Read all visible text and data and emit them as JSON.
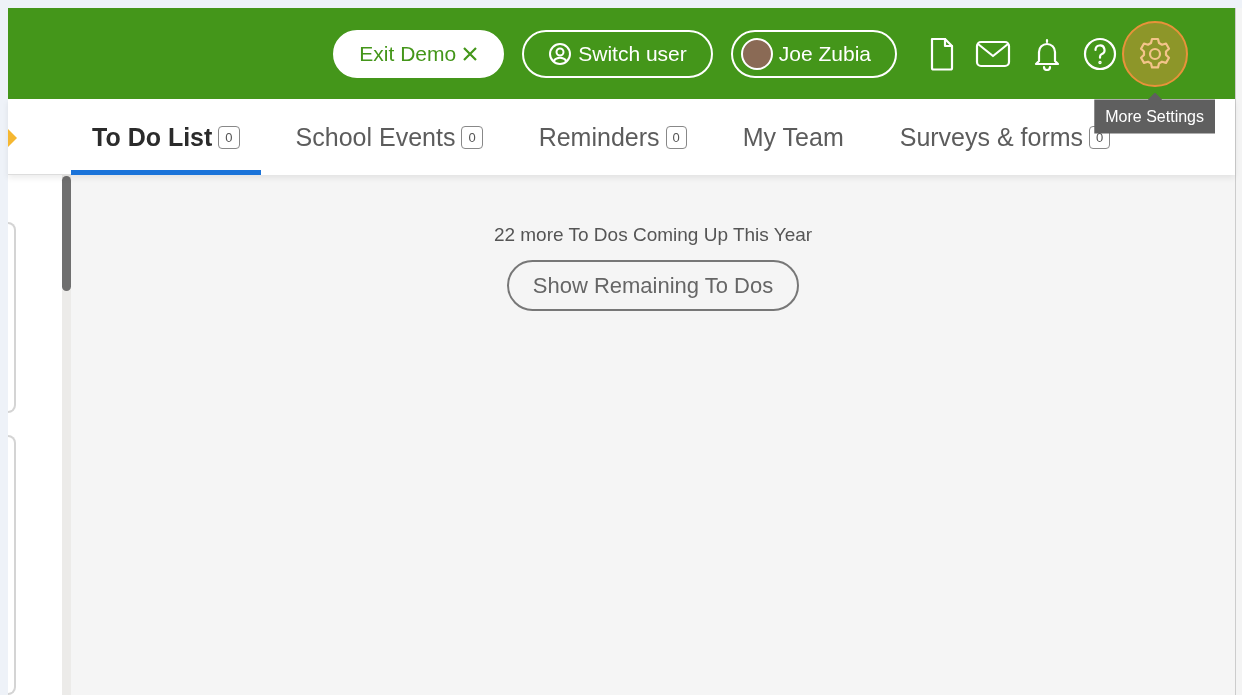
{
  "header": {
    "buttons": [
      {
        "kind": "exit",
        "label": "Exit Demo"
      },
      {
        "kind": "switch",
        "label": "Switch user"
      },
      {
        "kind": "profile",
        "label": "Joe Zubia"
      }
    ],
    "icons": [
      {
        "kind": "document"
      },
      {
        "kind": "mail"
      },
      {
        "kind": "bell"
      },
      {
        "kind": "help"
      },
      {
        "kind": "settings",
        "tooltip": "More Settings"
      }
    ]
  },
  "tabs": [
    {
      "label": "To Do List",
      "count": "0",
      "selected": true
    },
    {
      "label": "School Events",
      "count": "0",
      "selected": false
    },
    {
      "label": "Reminders",
      "count": "0",
      "selected": false
    },
    {
      "label": "My Team",
      "selected": false
    },
    {
      "label": "Surveys & forms",
      "count": "0",
      "selected": false
    }
  ],
  "main": {
    "message": "22 more To Dos Coming Up This Year",
    "button": "Show Remaining To Dos"
  }
}
